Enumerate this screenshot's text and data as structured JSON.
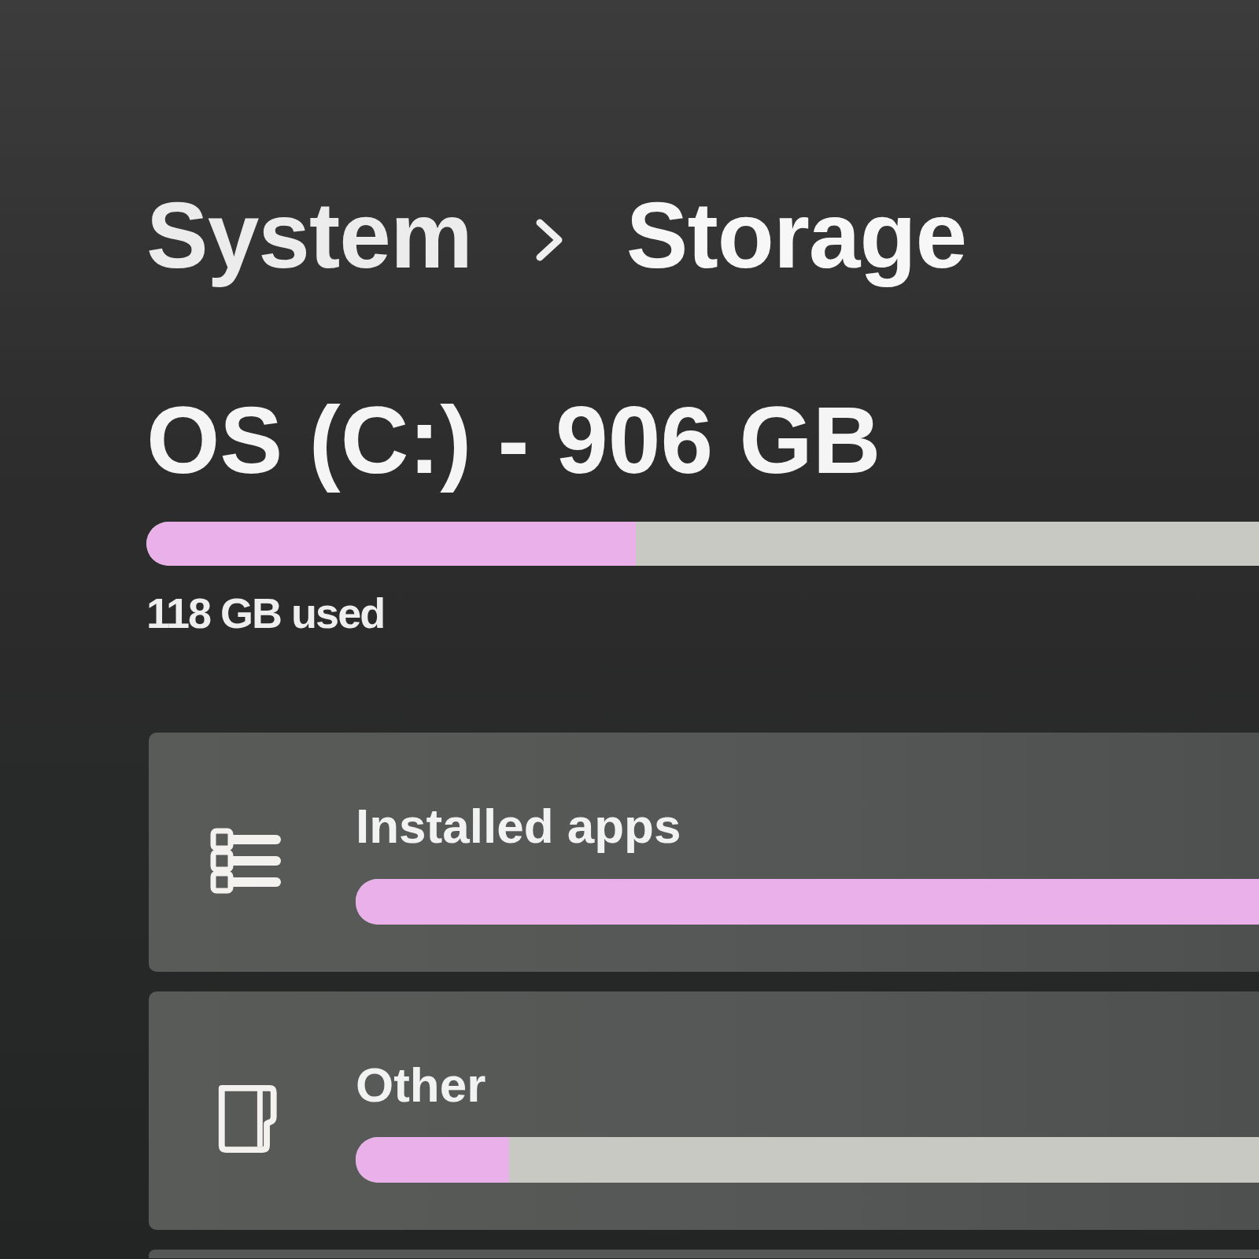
{
  "breadcrumb": [
    {
      "label": "System"
    },
    {
      "label": "Storage"
    }
  ],
  "drive": {
    "title": "OS (C:) - 906 GB",
    "level": 0.44,
    "usage": "118 GB used"
  },
  "categories": [
    {
      "kind": "apps",
      "label": "Installed apps",
      "level": 1
    },
    {
      "kind": "other",
      "label": "Other",
      "level": 0.17
    }
  ]
}
